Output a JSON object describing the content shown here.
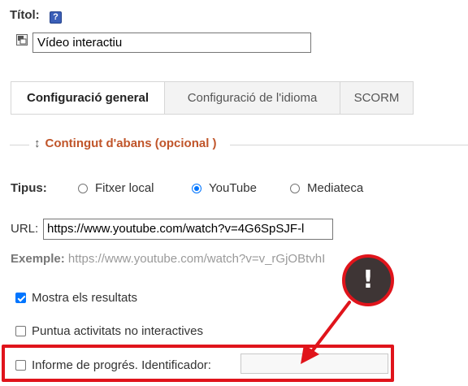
{
  "title_field": {
    "label": "Títol:",
    "help_icon": "?",
    "value": "Vídeo interactiu"
  },
  "tabs": [
    {
      "label": "Configuració general",
      "active": true
    },
    {
      "label": "Configuració de l'idioma",
      "active": false
    },
    {
      "label": "SCORM",
      "active": false
    }
  ],
  "section": {
    "arrow": "↕",
    "legend": "Contingut d'abans (opcional )"
  },
  "type": {
    "label": "Tipus:",
    "options": [
      {
        "label": "Fitxer local",
        "selected": false
      },
      {
        "label": "YouTube",
        "selected": true
      },
      {
        "label": "Mediateca",
        "selected": false
      }
    ]
  },
  "url": {
    "label": "URL:",
    "value": "https://www.youtube.com/watch?v=4G6SpSJF-l"
  },
  "example": {
    "label": "Exemple:",
    "value": "https://www.youtube.com/watch?v=v_rGjOBtvhI"
  },
  "checkboxes": {
    "show_results": {
      "label": "Mostra els resultats",
      "checked": true
    },
    "score_non_interactive": {
      "label": "Puntua activitats no interactives",
      "checked": false
    },
    "progress_report": {
      "label": "Informe de progrés. Identificador:",
      "checked": false,
      "identifier_value": ""
    }
  },
  "annotation": {
    "badge_symbol": "!",
    "color": "#e0141b"
  },
  "colors": {
    "accent": "#0075ff",
    "legend": "#c0552a",
    "annotation": "#e0141b"
  }
}
